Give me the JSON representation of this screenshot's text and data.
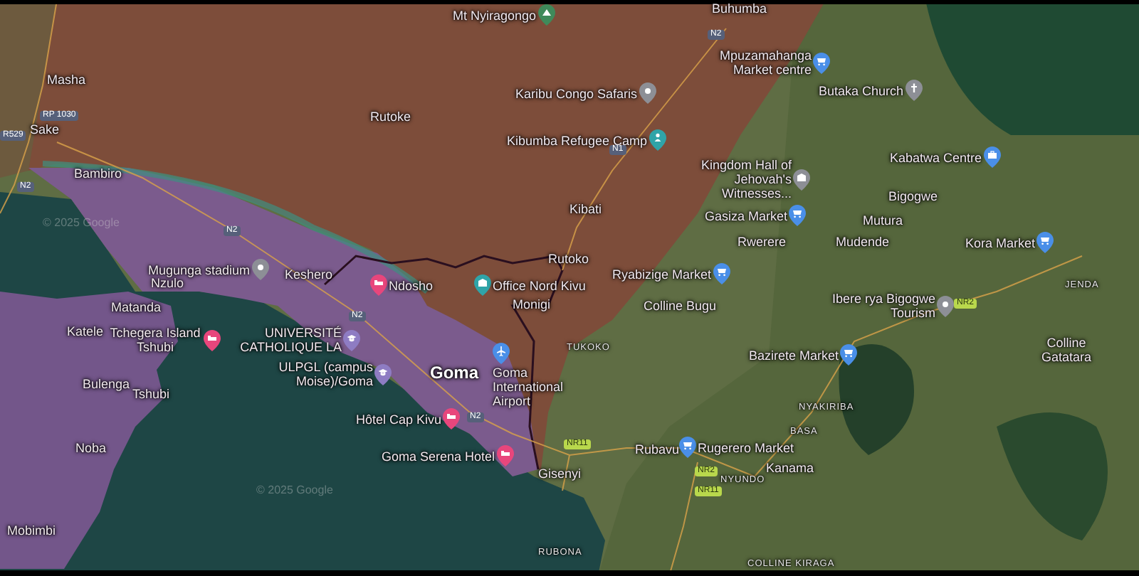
{
  "map": {
    "places": [
      {
        "name": "Mt Nyiragongo",
        "kind": "peak"
      },
      {
        "name": "Buhumba",
        "kind": "town"
      },
      {
        "name": "N2",
        "kind": "road_cd"
      },
      {
        "name": "Mpuzamahanga Market centre",
        "kind": "market"
      },
      {
        "name": "Masha",
        "kind": "town"
      },
      {
        "name": "Karibu Congo Safaris",
        "kind": "poi"
      },
      {
        "name": "Butaka Church",
        "kind": "church"
      },
      {
        "name": "RP 1030",
        "kind": "road_cd"
      },
      {
        "name": "Rutoke",
        "kind": "town"
      },
      {
        "name": "R529",
        "kind": "road_cd"
      },
      {
        "name": "Sake",
        "kind": "town"
      },
      {
        "name": "Kibumba Refugee Camp",
        "kind": "person"
      },
      {
        "name": "N1",
        "kind": "road_cd"
      },
      {
        "name": "Kabatwa Centre",
        "kind": "briefcase"
      },
      {
        "name": "N2",
        "kind": "road_cd"
      },
      {
        "name": "Bambiro",
        "kind": "town"
      },
      {
        "name": "Kingdom Hall of Jehovah's Witnesses...",
        "kind": "hall"
      },
      {
        "name": "Bigogwe",
        "kind": "town"
      },
      {
        "name": "© 2025 Google",
        "kind": "copyright"
      },
      {
        "name": "Kibati",
        "kind": "town"
      },
      {
        "name": "Gasiza Market",
        "kind": "market"
      },
      {
        "name": "Mutura",
        "kind": "town"
      },
      {
        "name": "N2",
        "kind": "road_cd"
      },
      {
        "name": "Rwerere",
        "kind": "town"
      },
      {
        "name": "Mudende",
        "kind": "town"
      },
      {
        "name": "Kora Market",
        "kind": "market"
      },
      {
        "name": "Rutoko",
        "kind": "town"
      },
      {
        "name": "Mugunga stadium",
        "kind": "poi"
      },
      {
        "name": "Nzulo",
        "kind": "town"
      },
      {
        "name": "Keshero",
        "kind": "town"
      },
      {
        "name": "Ndosho",
        "kind": "hotel"
      },
      {
        "name": "Office Nord Kivu",
        "kind": "office"
      },
      {
        "name": "Ryabizige Market",
        "kind": "market"
      },
      {
        "name": "JENDA",
        "kind": "locality"
      },
      {
        "name": "Matanda",
        "kind": "town"
      },
      {
        "name": "Monigi",
        "kind": "town"
      },
      {
        "name": "Colline Bugu",
        "kind": "town"
      },
      {
        "name": "Ibere rya Bigogwe Tourism",
        "kind": "poi"
      },
      {
        "name": "NR2",
        "kind": "road_rw"
      },
      {
        "name": "N2",
        "kind": "road_cd"
      },
      {
        "name": "Katele",
        "kind": "town"
      },
      {
        "name": "Tchegera Island Tshubi",
        "kind": "hotel"
      },
      {
        "name": "UNIVERSITÉ CATHOLIQUE LA",
        "kind": "school"
      },
      {
        "name": "TUKOKO",
        "kind": "locality"
      },
      {
        "name": "Bazirete Market",
        "kind": "market"
      },
      {
        "name": "Colline Gatatara",
        "kind": "town"
      },
      {
        "name": "Bulenga",
        "kind": "town"
      },
      {
        "name": "Tshubi",
        "kind": "town"
      },
      {
        "name": "ULPGL (campus Moise)/Goma",
        "kind": "school"
      },
      {
        "name": "Goma",
        "kind": "city"
      },
      {
        "name": "Goma International Airport",
        "kind": "airport"
      },
      {
        "name": "NYAKIRIBA",
        "kind": "locality"
      },
      {
        "name": "Hôtel Cap Kivu",
        "kind": "hotel"
      },
      {
        "name": "N2",
        "kind": "road_cd"
      },
      {
        "name": "BASA",
        "kind": "locality"
      },
      {
        "name": "Noba",
        "kind": "town"
      },
      {
        "name": "Goma Serena Hotel",
        "kind": "hotel"
      },
      {
        "name": "NR11",
        "kind": "road_rw"
      },
      {
        "name": "Rubavu",
        "kind": "town"
      },
      {
        "name": "Rugerero Market",
        "kind": "market"
      },
      {
        "name": "Gisenyi",
        "kind": "town"
      },
      {
        "name": "NR2",
        "kind": "road_rw"
      },
      {
        "name": "NYUNDO",
        "kind": "locality"
      },
      {
        "name": "Kanama",
        "kind": "town"
      },
      {
        "name": "© 2025 Google",
        "kind": "copyright"
      },
      {
        "name": "NR11",
        "kind": "road_rw"
      },
      {
        "name": "Mobimbi",
        "kind": "town"
      },
      {
        "name": "RUBONA",
        "kind": "locality"
      },
      {
        "name": "COLLINE KIRAGA",
        "kind": "locality"
      }
    ]
  }
}
